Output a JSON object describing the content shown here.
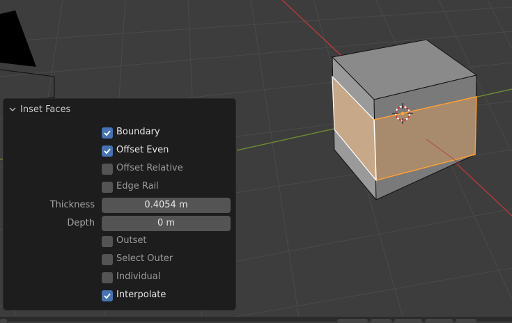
{
  "panel": {
    "title": "Inset Faces",
    "checkboxes_top": [
      {
        "label": "Boundary",
        "checked": true
      },
      {
        "label": "Offset Even",
        "checked": true
      },
      {
        "label": "Offset Relative",
        "checked": false
      },
      {
        "label": "Edge Rail",
        "checked": false
      }
    ],
    "thickness": {
      "label": "Thickness",
      "value": "0.4054 m"
    },
    "depth": {
      "label": "Depth",
      "value": "0 m"
    },
    "checkboxes_bottom": [
      {
        "label": "Outset",
        "checked": false
      },
      {
        "label": "Select Outer",
        "checked": false
      },
      {
        "label": "Individual",
        "checked": false
      },
      {
        "label": "Interpolate",
        "checked": true
      }
    ]
  },
  "colors": {
    "viewport_bg": "#3d3d3d",
    "grid": "#4a4a4a",
    "x_axis": "#b03a3a",
    "y_axis": "#6b8a30",
    "selection": "#ffa033",
    "checkbox_on": "#4772b3",
    "panel_bg": "#1d1d1d"
  }
}
